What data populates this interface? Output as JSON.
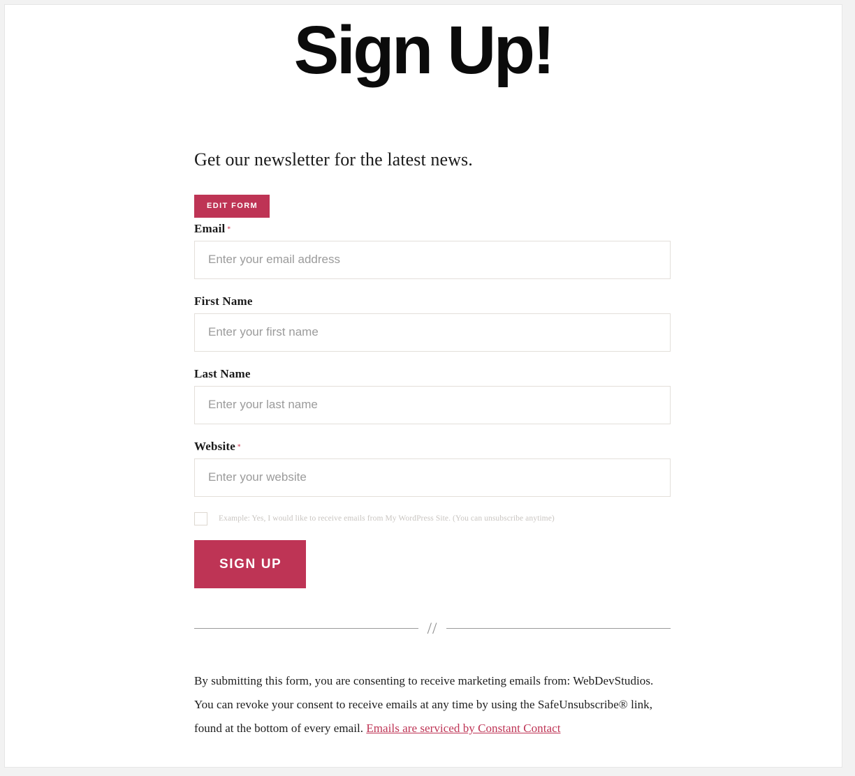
{
  "page": {
    "title": "Sign Up!"
  },
  "form": {
    "heading": "Get our newsletter for the latest news.",
    "edit_button_label": "EDIT FORM",
    "required_marker": "*",
    "accent_color": "#be3455",
    "fields": [
      {
        "label": "Email",
        "required": true,
        "placeholder": "Enter your email address",
        "value": ""
      },
      {
        "label": "First Name",
        "required": false,
        "placeholder": "Enter your first name",
        "value": ""
      },
      {
        "label": "Last Name",
        "required": false,
        "placeholder": "Enter your last name",
        "value": ""
      },
      {
        "label": "Website",
        "required": true,
        "placeholder": "Enter your website",
        "value": ""
      }
    ],
    "consent": {
      "checked": false,
      "label": "Example: Yes, I would like to receive emails from My WordPress Site. (You can unsubscribe anytime)"
    },
    "submit_label": "SIGN UP"
  },
  "divider": {
    "mark": "//"
  },
  "legal": {
    "text": "By submitting this form, you are consenting to receive marketing emails from: WebDevStudios. You can revoke your consent to receive emails at any time by using the SafeUnsubscribe® link, found at the bottom of every email. ",
    "link_text": "Emails are serviced by Constant Contact"
  }
}
